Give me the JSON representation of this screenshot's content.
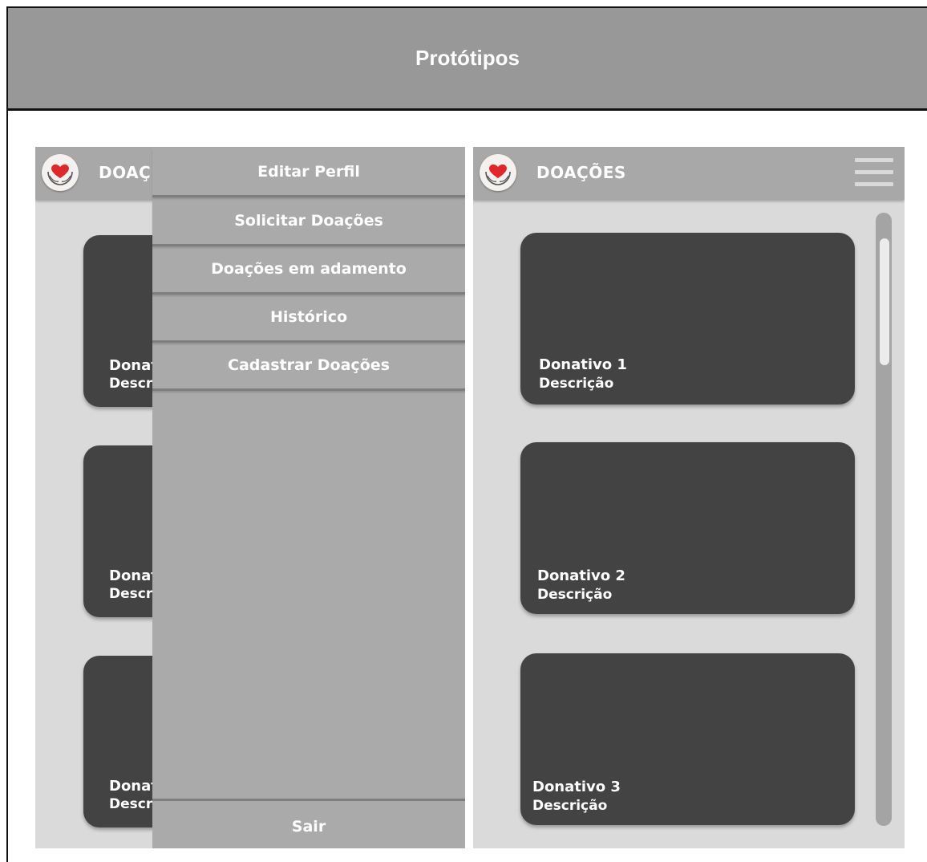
{
  "page": {
    "title": "Protótipos"
  },
  "app": {
    "title": "DOAÇÕES",
    "title_truncated": "DOAÇ",
    "logo_icon": "heart-hands-icon",
    "menu_icon": "hamburger-menu-icon"
  },
  "drawer": {
    "items": [
      {
        "label": "Editar Perfil"
      },
      {
        "label": "Solicitar Doações"
      },
      {
        "label": "Doações em adamento"
      },
      {
        "label": "Histórico"
      },
      {
        "label": "Cadastrar Doações"
      }
    ],
    "logout_label": "Sair"
  },
  "left_cards": [
    {
      "title": "Donat",
      "description": "Descri"
    },
    {
      "title": "Donat",
      "description": "Descri"
    },
    {
      "title": "Donat",
      "description": "Descri"
    }
  ],
  "cards": [
    {
      "title": "Donativo 1",
      "description": "Descrição"
    },
    {
      "title": "Donativo 2",
      "description": "Descrição"
    },
    {
      "title": "Donativo 3",
      "description": "Descrição"
    }
  ],
  "colors": {
    "title_bar": "#989898",
    "app_bar": "#a8a8a8",
    "drawer": "#aaaaaa",
    "card": "#434343",
    "screen_bg": "#dadada",
    "heart": "#e3262a"
  }
}
